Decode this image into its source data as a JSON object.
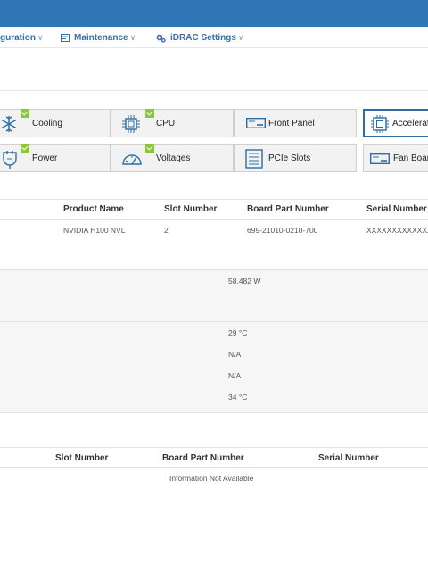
{
  "menu": {
    "configuration": "guration",
    "maintenance": "Maintenance",
    "idrac_settings": "iDRAC Settings"
  },
  "tiles": {
    "cooling": "Cooling",
    "cpu": "CPU",
    "front_panel": "Front Panel",
    "accelerators": "Accelerat",
    "power": "Power",
    "voltages": "Voltages",
    "pcie_slots": "PCIe Slots",
    "fan_board": "Fan Boar"
  },
  "accelerators_table": {
    "headers": {
      "product_name": "Product Name",
      "slot_number": "Slot Number",
      "board_part_number": "Board Part Number",
      "serial_number": "Serial Number"
    },
    "row": {
      "product_name": "NVIDIA H100 NVL",
      "slot_number": "2",
      "board_part_number": "699-21010-0210-700",
      "serial_number": "XXXXXXXXXXXXX"
    },
    "power": "58.482 W",
    "temperatures": [
      "29 °C",
      "N/A",
      "N/A",
      "34 °C"
    ]
  },
  "second_table": {
    "headers": {
      "slot_number": "Slot Number",
      "board_part_number": "Board Part Number",
      "serial_number": "Serial Number"
    },
    "empty_message": "Information Not Available"
  },
  "colors": {
    "header_blue": "#2f76b6",
    "menu_text": "#3a6ea5",
    "status_ok": "#8cc63f",
    "active_border": "#2e6da4"
  }
}
